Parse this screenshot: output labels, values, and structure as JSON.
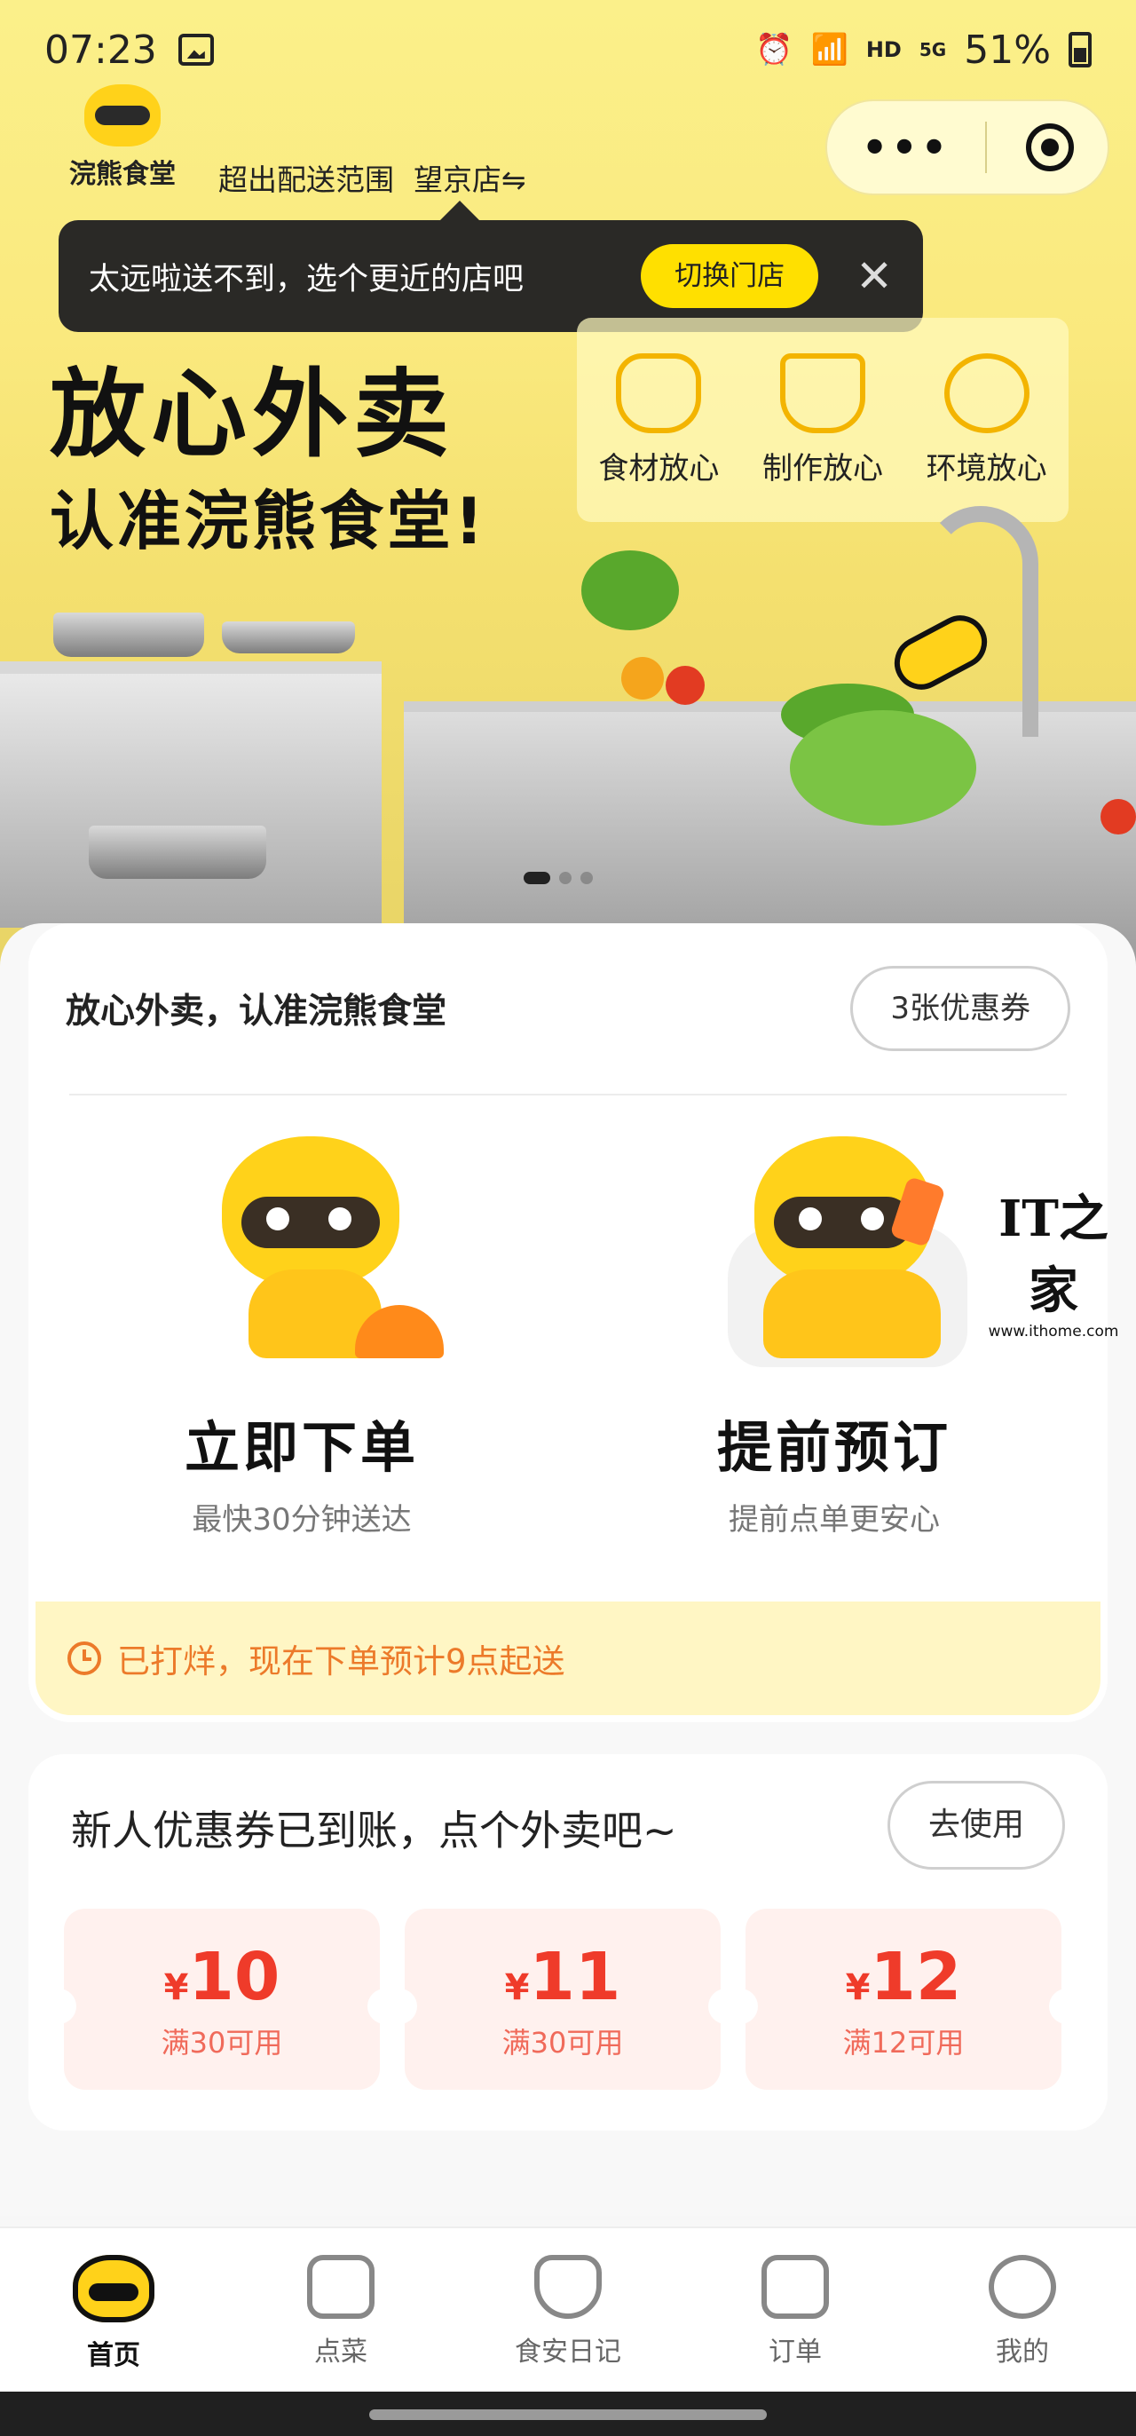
{
  "status_bar": {
    "time": "07:23",
    "hd_label": "HD",
    "net_label": "5G",
    "battery": "51%"
  },
  "header": {
    "logo_text": "浣熊食堂",
    "store_status": "超出配送范围",
    "store_name": "望京店⇋"
  },
  "capsule": {
    "more_label": "•••"
  },
  "tooltip": {
    "message": "太远啦送不到，选个更近的店吧",
    "switch_button": "切换门店",
    "close_symbol": "✕"
  },
  "banner": {
    "title": "放心外卖",
    "subtitle": "认准浣熊食堂!",
    "assurances": [
      "食材放心",
      "制作放心",
      "环境放心"
    ],
    "slide_count": 3,
    "active_slide": 0
  },
  "order_card": {
    "slogan": "放心外卖，认准浣熊食堂",
    "coupon_count_button": "3张优惠券",
    "order_now": {
      "title": "立即下单",
      "subtitle": "最快30分钟送达"
    },
    "pre_order": {
      "title": "提前预订",
      "subtitle": "提前点单更安心"
    },
    "notice": "已打烊，现在下单预计9点起送"
  },
  "coupons": {
    "title": "新人优惠券已到账，点个外卖吧~",
    "use_button": "去使用",
    "currency": "¥",
    "items": [
      {
        "amount": "10",
        "condition": "满30可用"
      },
      {
        "amount": "11",
        "condition": "满30可用"
      },
      {
        "amount": "12",
        "condition": "满12可用"
      }
    ]
  },
  "watermark": {
    "logo": "IT之家",
    "url": "www.ithome.com"
  },
  "tabbar": {
    "tabs": [
      {
        "label": "首页",
        "icon": "home-raccoon-icon",
        "active": true
      },
      {
        "label": "点菜",
        "icon": "order-bag-icon",
        "active": false
      },
      {
        "label": "食安日记",
        "icon": "shield-icon",
        "active": false
      },
      {
        "label": "订单",
        "icon": "order-list-icon",
        "active": false
      },
      {
        "label": "我的",
        "icon": "profile-icon",
        "active": false
      }
    ]
  },
  "colors": {
    "brand_yellow": "#ffe000",
    "accent_orange": "#ec7a2a",
    "coupon_red": "#ef3b2a"
  }
}
